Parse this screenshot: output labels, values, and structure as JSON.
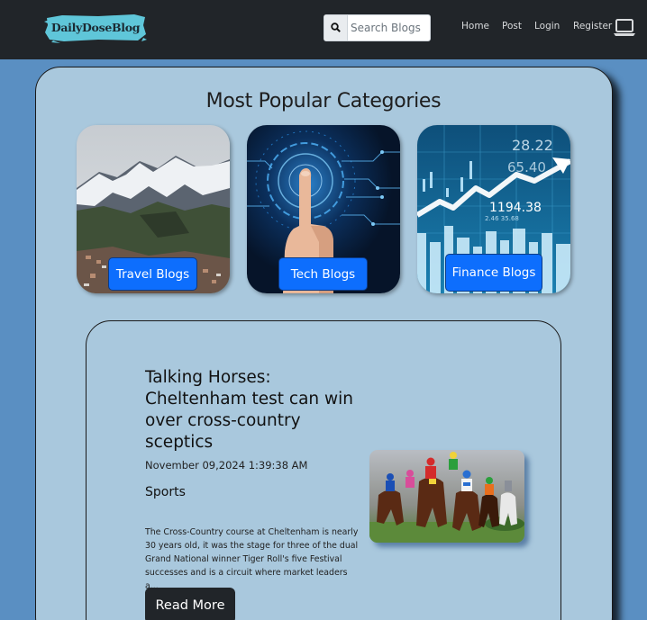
{
  "navbar": {
    "logo": "DailyDoseBlog",
    "search_placeholder": "Search Blogs",
    "links": [
      "Home",
      "Post",
      "Login",
      "Register"
    ],
    "device_icon": "laptop-icon"
  },
  "categories": {
    "title": "Most Popular Categories",
    "items": [
      {
        "label": "Travel Blogs",
        "image": "snowy-mountain-valley"
      },
      {
        "label": "Tech Blogs",
        "image": "finger-touching-circuit"
      },
      {
        "label": "Finance Blogs",
        "image": "stock-market-chart"
      }
    ]
  },
  "post": {
    "title": "Talking Horses: Cheltenham test can win over cross-country sceptics",
    "date": "November 09,2024 1:39:38 AM",
    "category": "Sports",
    "excerpt": "The Cross-Country course at Cheltenham is nearly 30 years old, it was the stage for three of the dual Grand National winner Tiger Roll's five Festival successes and is a circuit where market leaders a...",
    "read_more": "Read More",
    "image": "horse-race"
  },
  "colors": {
    "navbar": "#212529",
    "page_bg": "#5a8fc2",
    "panel_bg": "#a9c8dd",
    "primary_button": "#0d6efd",
    "dark_button": "#212529",
    "logo_badge": "#5fc6d9"
  }
}
